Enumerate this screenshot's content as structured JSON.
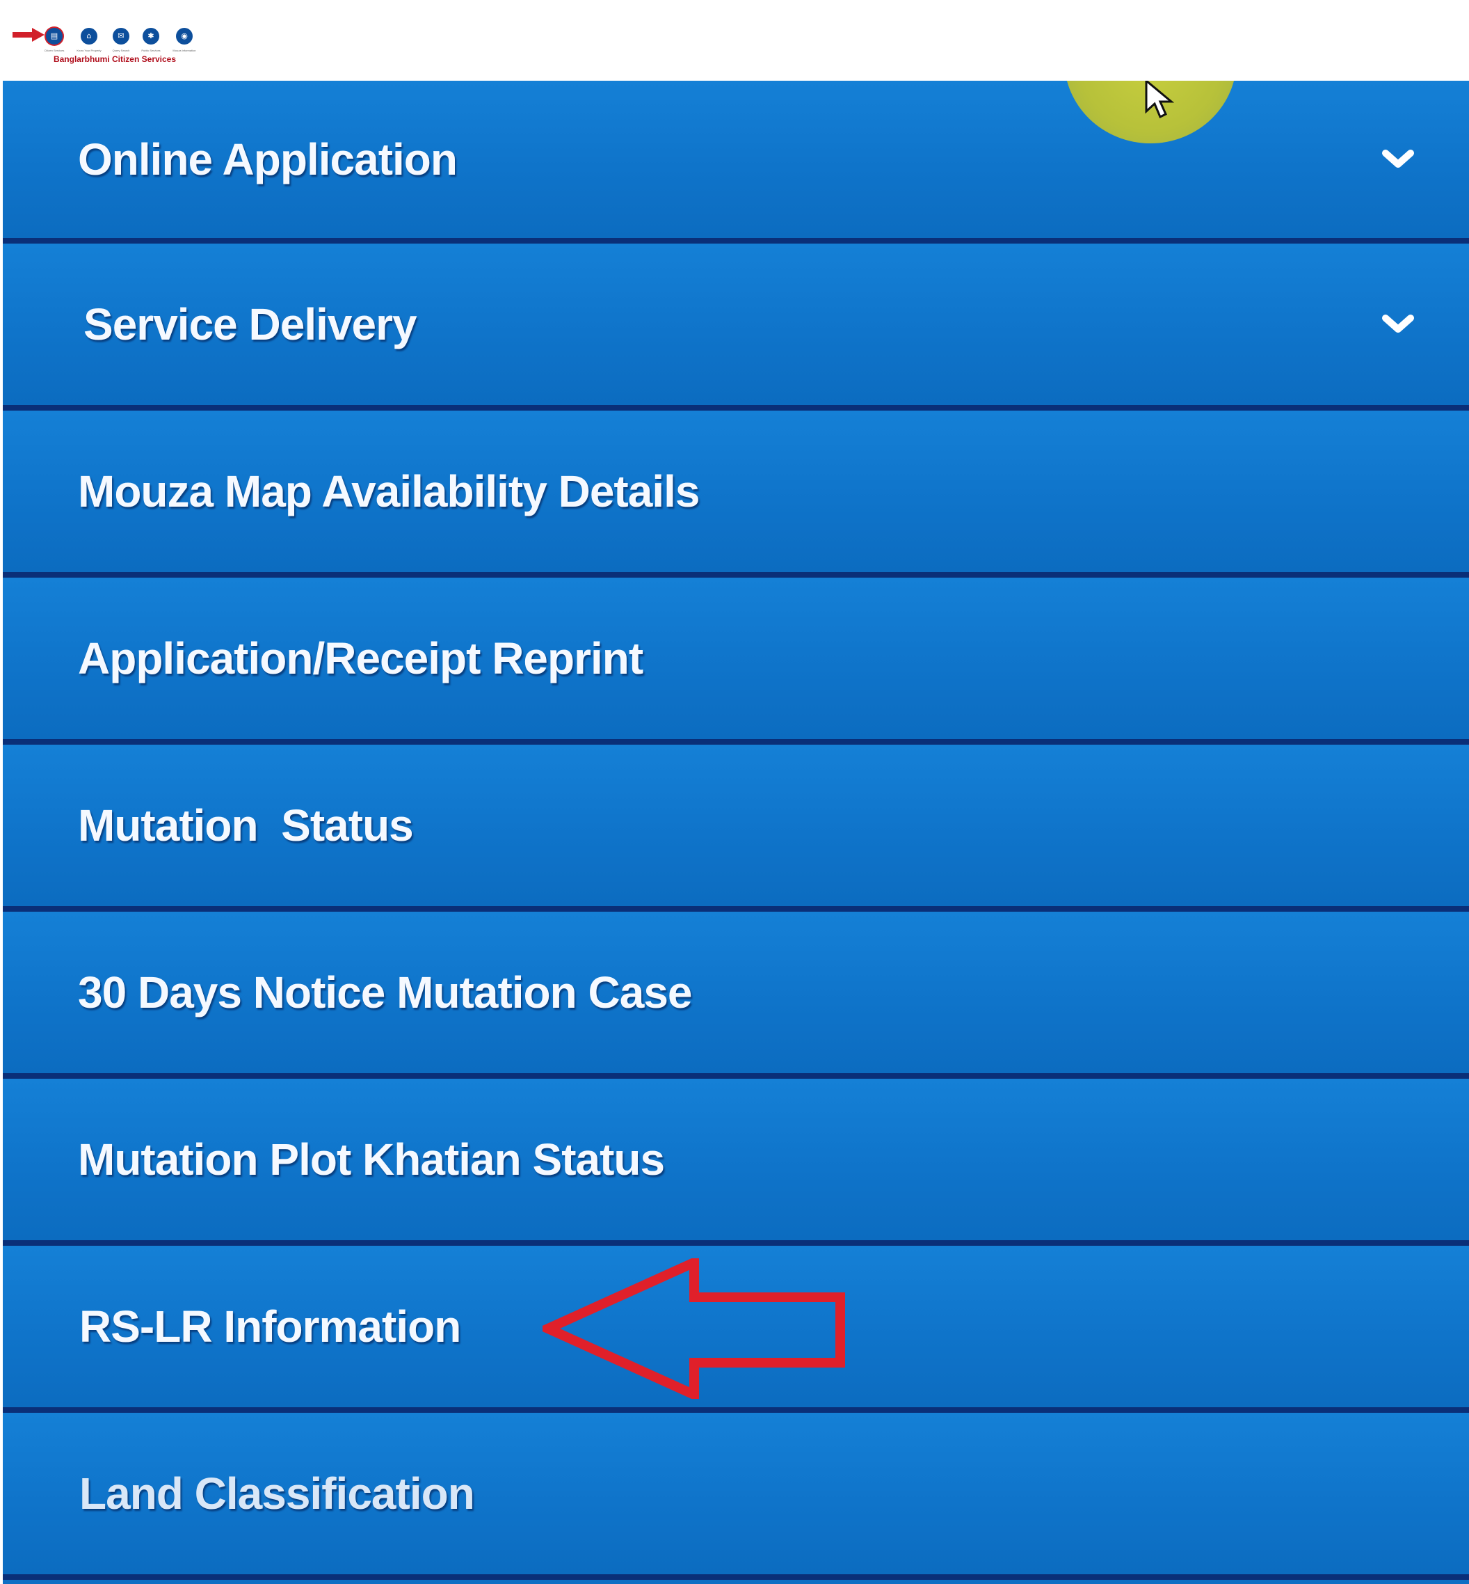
{
  "header": {
    "brand_title": "Banglarbhumi Citizen Services",
    "nav_icons": [
      {
        "icon": "citizen-services-icon",
        "caption": "Citizen Services",
        "active": true
      },
      {
        "icon": "home-icon",
        "caption": "Know Your Property",
        "active": false
      },
      {
        "icon": "chat-icon",
        "caption": "Query Search",
        "active": false
      },
      {
        "icon": "public-services-icon",
        "caption": "Public Services",
        "active": false
      },
      {
        "icon": "mouza-info-icon",
        "caption": "Mouza Information",
        "active": false
      }
    ]
  },
  "menu": {
    "items": [
      {
        "label": "Online Application",
        "expandable": true
      },
      {
        "label": "Service Delivery",
        "expandable": true
      },
      {
        "label": "Mouza Map Availability Details",
        "expandable": false
      },
      {
        "label": "Application/Receipt Reprint",
        "expandable": false
      },
      {
        "label": "Mutation  Status",
        "expandable": false
      },
      {
        "label": "30 Days Notice Mutation Case",
        "expandable": false
      },
      {
        "label": "Mutation Plot Khatian Status",
        "expandable": false
      },
      {
        "label": "RS-LR Information",
        "expandable": false
      },
      {
        "label": "Land Classification",
        "expandable": false
      }
    ]
  },
  "colors": {
    "menu_blue": "#1580d6",
    "divider_navy": "#0a2f78",
    "annotation_red": "#e0202a",
    "brand_red": "#b00e1c",
    "cursor_highlight": "#c8cf3e"
  }
}
